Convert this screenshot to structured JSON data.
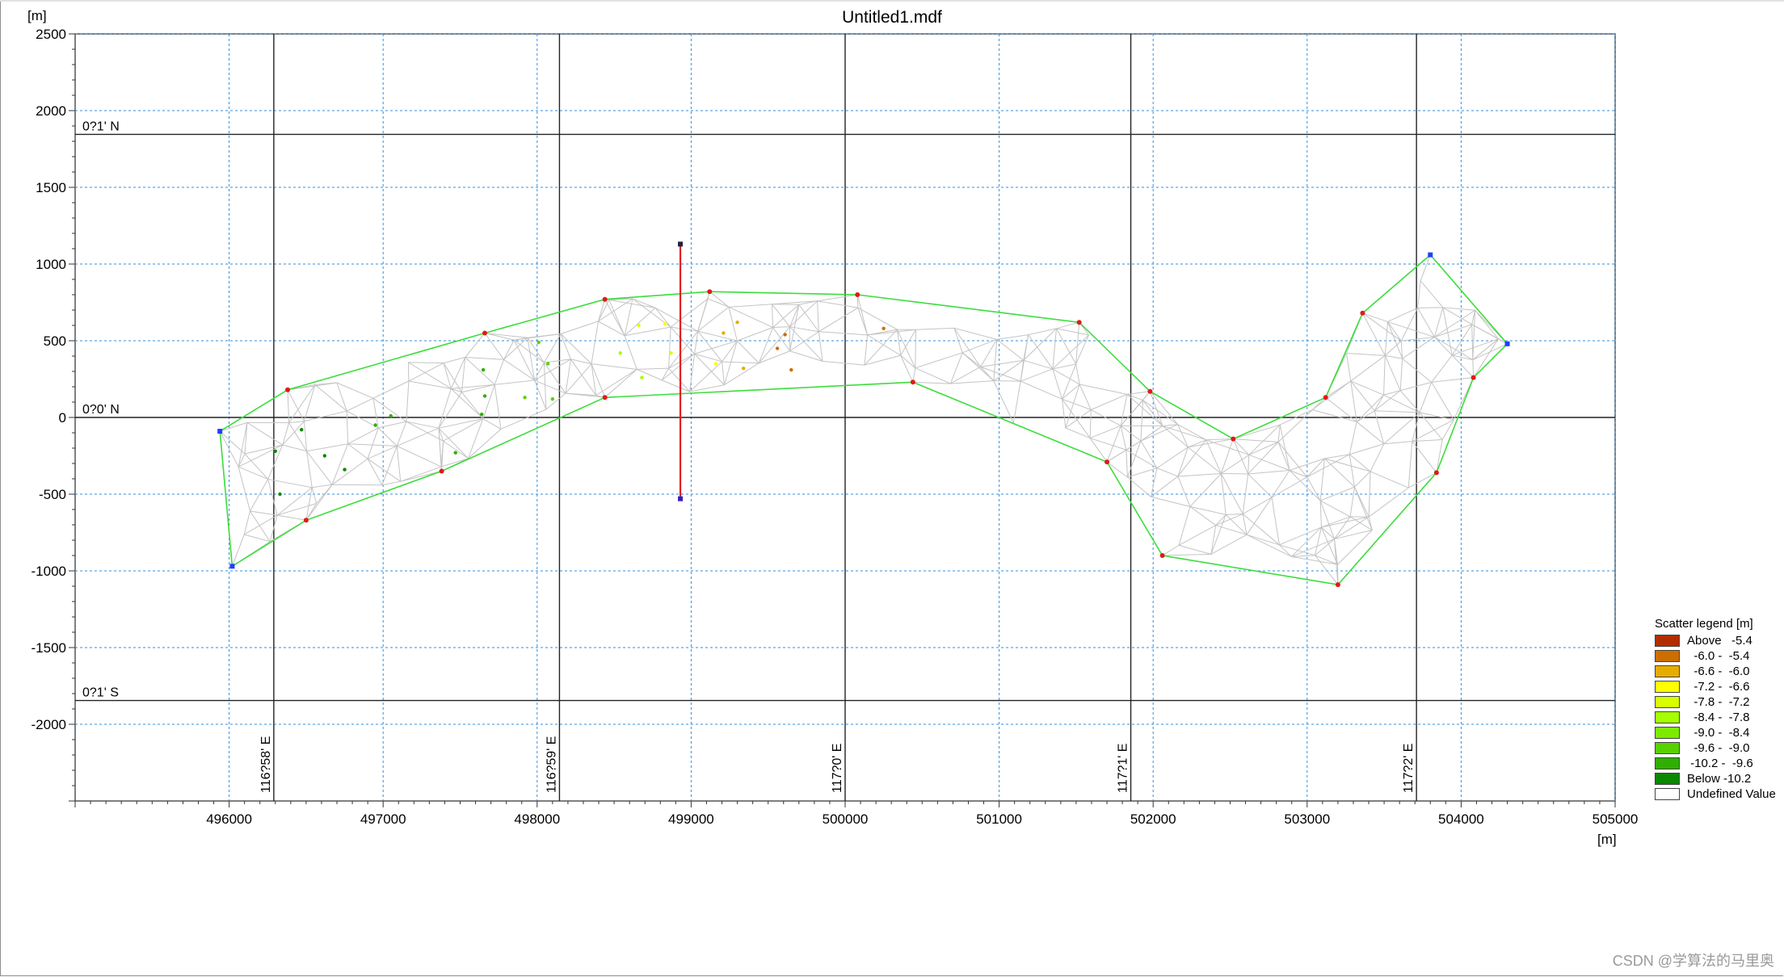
{
  "window": {
    "title": "Untitled1.mdf"
  },
  "axes": {
    "y_unit": "[m]",
    "x_unit": "[m]",
    "y_ticks": [
      "2500",
      "2000",
      "1500",
      "1000",
      "500",
      "0",
      "-500",
      "-1000",
      "-1500",
      "-2000"
    ],
    "y_tick_values": [
      2500,
      2000,
      1500,
      1000,
      500,
      0,
      -500,
      -1000,
      -1500,
      -2000
    ],
    "x_ticks": [
      "496000",
      "497000",
      "498000",
      "499000",
      "500000",
      "501000",
      "502000",
      "503000",
      "504000",
      "505000"
    ],
    "x_tick_values": [
      496000,
      497000,
      498000,
      499000,
      500000,
      501000,
      502000,
      503000,
      504000,
      505000
    ],
    "xlim": [
      495000,
      505000
    ],
    "ylim": [
      -2500,
      2500
    ],
    "grid": "dotted blue"
  },
  "geo_grid": {
    "latitudes": [
      {
        "label": "0?1' N",
        "y": 1845
      },
      {
        "label": "0?0' N",
        "y": 0
      },
      {
        "label": "0?1' S",
        "y": -1845
      }
    ],
    "longitudes": [
      {
        "label": "116?58' E",
        "x": 496290
      },
      {
        "label": "116?59' E",
        "x": 498145
      },
      {
        "label": "117?0' E",
        "x": 500000
      },
      {
        "label": "117?1' E",
        "x": 501855
      },
      {
        "label": "117?2' E",
        "x": 503710
      }
    ]
  },
  "legend": {
    "title": "Scatter legend [m]",
    "items": [
      {
        "label": "Above   -5.4",
        "color": "#b22c00"
      },
      {
        "label": "  -6.0 -  -5.4",
        "color": "#cc6e00"
      },
      {
        "label": "  -6.6 -  -6.0",
        "color": "#e6ad00"
      },
      {
        "label": "  -7.2 -  -6.6",
        "color": "#ffff00"
      },
      {
        "label": "  -7.8 -  -7.2",
        "color": "#d8ff00"
      },
      {
        "label": "  -8.4 -  -7.8",
        "color": "#a6ff00"
      },
      {
        "label": "  -9.0 -  -8.4",
        "color": "#7eea00"
      },
      {
        "label": "  -9.6 -  -9.0",
        "color": "#57d100"
      },
      {
        "label": " -10.2 -  -9.6",
        "color": "#2fb000"
      },
      {
        "label": "Below -10.2",
        "color": "#0a8800"
      },
      {
        "label": "Undefined Value",
        "color": "#ffffff"
      }
    ]
  },
  "watermark": "CSDN @学算法的马里奥",
  "chart_data": {
    "type": "scatter",
    "boundary_polygon": [
      [
        495940,
        -90
      ],
      [
        496380,
        180
      ],
      [
        497660,
        550
      ],
      [
        498440,
        770
      ],
      [
        499120,
        820
      ],
      [
        500080,
        800
      ],
      [
        501520,
        620
      ],
      [
        501980,
        170
      ],
      [
        502520,
        -140
      ],
      [
        503120,
        130
      ],
      [
        503360,
        680
      ],
      [
        503800,
        1060
      ],
      [
        504300,
        480
      ],
      [
        504080,
        260
      ],
      [
        503840,
        -360
      ],
      [
        503200,
        -1090
      ],
      [
        502060,
        -900
      ],
      [
        501700,
        -290
      ],
      [
        500440,
        230
      ],
      [
        498440,
        130
      ],
      [
        497380,
        -350
      ],
      [
        496500,
        -670
      ],
      [
        496020,
        -970
      ]
    ],
    "boundary_vertex_kinds": [
      "blue",
      "red",
      "red",
      "red",
      "red",
      "red",
      "red",
      "red",
      "red",
      "red",
      "red",
      "blue",
      "blue",
      "red",
      "red",
      "red",
      "red",
      "red",
      "red",
      "red",
      "red",
      "red",
      "blue"
    ],
    "section_line": {
      "x": 498930,
      "y_start": 1130,
      "y_end": -530
    },
    "scatter_points": [
      {
        "x": 496300,
        "y": -220,
        "bin": 9
      },
      {
        "x": 496330,
        "y": -500,
        "bin": 9
      },
      {
        "x": 496470,
        "y": -80,
        "bin": 9
      },
      {
        "x": 496620,
        "y": -250,
        "bin": 9
      },
      {
        "x": 496750,
        "y": -340,
        "bin": 9
      },
      {
        "x": 496950,
        "y": -50,
        "bin": 8
      },
      {
        "x": 497050,
        "y": 10,
        "bin": 8
      },
      {
        "x": 497470,
        "y": -230,
        "bin": 8
      },
      {
        "x": 497650,
        "y": 310,
        "bin": 8
      },
      {
        "x": 497660,
        "y": 140,
        "bin": 8
      },
      {
        "x": 497640,
        "y": 20,
        "bin": 8
      },
      {
        "x": 497920,
        "y": 130,
        "bin": 7
      },
      {
        "x": 498010,
        "y": 490,
        "bin": 7
      },
      {
        "x": 498070,
        "y": 350,
        "bin": 7
      },
      {
        "x": 498100,
        "y": 120,
        "bin": 7
      },
      {
        "x": 498540,
        "y": 420,
        "bin": 5
      },
      {
        "x": 498660,
        "y": 600,
        "bin": 4
      },
      {
        "x": 498680,
        "y": 260,
        "bin": 5
      },
      {
        "x": 498830,
        "y": 610,
        "bin": 3
      },
      {
        "x": 498870,
        "y": 420,
        "bin": 4
      },
      {
        "x": 499160,
        "y": 350,
        "bin": 3
      },
      {
        "x": 499210,
        "y": 550,
        "bin": 2
      },
      {
        "x": 499300,
        "y": 620,
        "bin": 2
      },
      {
        "x": 499340,
        "y": 320,
        "bin": 2
      },
      {
        "x": 499560,
        "y": 450,
        "bin": 1
      },
      {
        "x": 499610,
        "y": 540,
        "bin": 1
      },
      {
        "x": 499650,
        "y": 310,
        "bin": 1
      },
      {
        "x": 500250,
        "y": 580,
        "bin": 1
      }
    ]
  }
}
